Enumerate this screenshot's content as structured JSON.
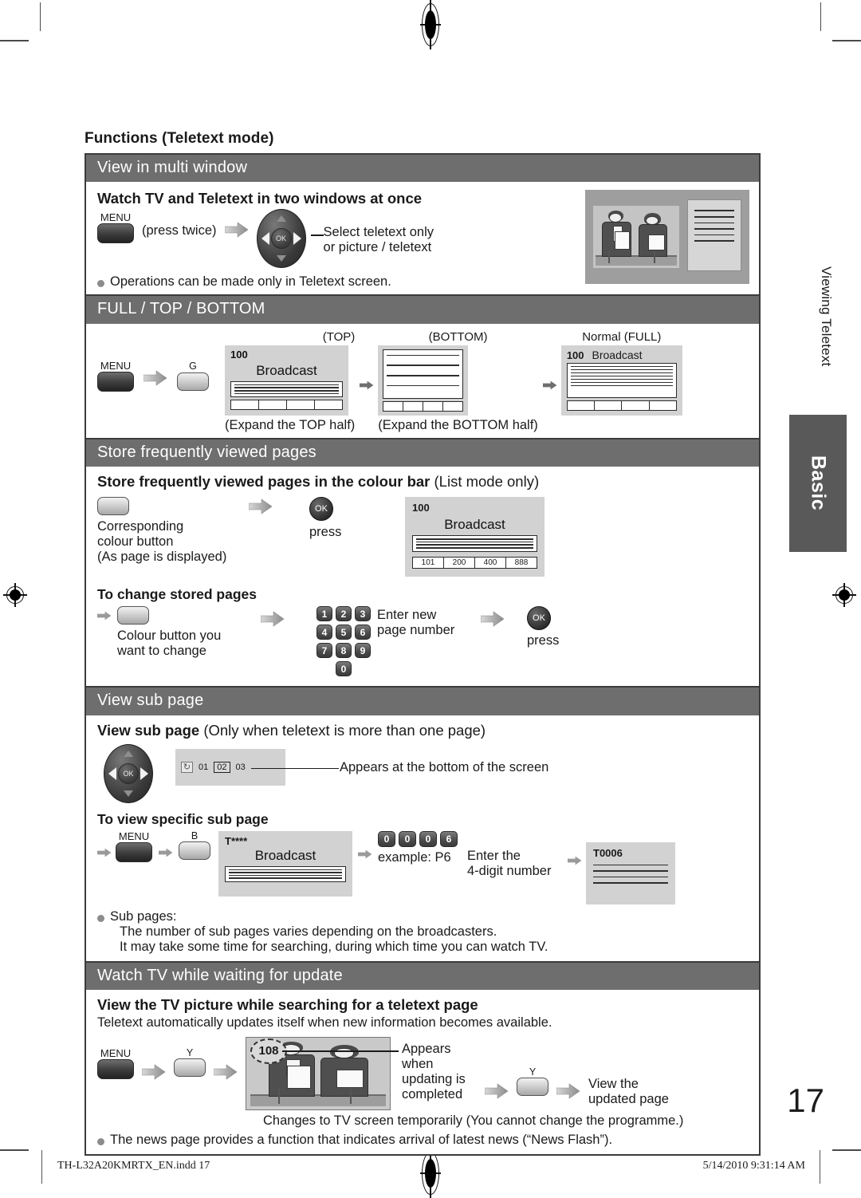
{
  "page": {
    "number": "17",
    "chapter_side_label": "Viewing Teletext",
    "tab_label": "Basic",
    "title": "Functions (Teletext mode)"
  },
  "footer": {
    "file": "TH-L32A20KMRTX_EN.indd   17",
    "timestamp": "5/14/2010   9:31:14 AM"
  },
  "sections": {
    "multi_window": {
      "bar": "View in multi window",
      "heading": "Watch TV and Teletext in two windows at once",
      "menu_label": "MENU",
      "press_twice": "(press twice)",
      "callout_line1": "Select teletext only",
      "callout_line2": "or picture / teletext",
      "note": "Operations can be made only in Teletext screen."
    },
    "full_top_bottom": {
      "bar": "FULL / TOP / BOTTOM",
      "menu_label": "MENU",
      "colour_button": "G",
      "label_top": "(TOP)",
      "label_bottom": "(BOTTOM)",
      "label_full": "Normal (FULL)",
      "caption_top": "(Expand the TOP half)",
      "caption_bottom": "(Expand the BOTTOM half)",
      "screen_page": "100",
      "screen_text": "Broadcast"
    },
    "store_pages": {
      "bar": "Store frequently viewed pages",
      "heading_bold": "Store frequently viewed pages in the colour bar",
      "heading_regular": " (List mode only)",
      "step1_line1": "Corresponding",
      "step1_line2": "colour button",
      "step1_line3": "(As page is displayed)",
      "press_label": "press",
      "ok_label": "OK",
      "screen_page": "100",
      "screen_text": "Broadcast",
      "colour_bar": [
        "101",
        "200",
        "400",
        "888"
      ],
      "change_heading": "To change stored pages",
      "change_line1": "Colour button you",
      "change_line2": "want to change",
      "enter_line1": "Enter new",
      "enter_line2": "page number",
      "numpad": [
        [
          "1",
          "2",
          "3"
        ],
        [
          "4",
          "5",
          "6"
        ],
        [
          "7",
          "8",
          "9"
        ],
        [
          "0"
        ]
      ],
      "press_label2": "press"
    },
    "view_sub_page": {
      "bar": "View sub page",
      "heading_bold": "View sub page",
      "heading_regular": " (Only when teletext is more than one page)",
      "indicator_pages": [
        "01",
        "02",
        "03"
      ],
      "indicator_selected": "02",
      "appears_text": "Appears at the bottom of the screen",
      "specific_heading": "To view specific sub page",
      "menu_label": "MENU",
      "colour_button": "B",
      "screen_code": "T****",
      "screen_text": "Broadcast",
      "digit_keys": [
        "0",
        "0",
        "0",
        "6"
      ],
      "example": "example: P6",
      "enter_line1": "Enter the",
      "enter_line2": "4-digit number",
      "result_code": "T0006",
      "note_title": "Sub pages:",
      "note_line1": "The number of sub pages varies depending on the broadcasters.",
      "note_line2": "It may take some time for searching, during which time you can watch TV."
    },
    "waiting_update": {
      "bar": "Watch TV while waiting for update",
      "heading": "View the TV picture while searching for a teletext page",
      "subtext": "Teletext automatically updates itself when new information becomes available.",
      "menu_label": "MENU",
      "colour_button_1": "Y",
      "colour_button_2": "Y",
      "tv_page_number": "108",
      "callout_l1": "Appears",
      "callout_l2": "when",
      "callout_l3": "updating is",
      "callout_l4": "completed",
      "view_l1": "View the",
      "view_l2": "updated page",
      "caption": "Changes to TV screen temporarily (You cannot change the programme.)",
      "note": "The news page provides a function that indicates arrival of latest news (“News Flash”)."
    }
  },
  "colors": {
    "bar_bg": "#6e6e6e",
    "tab_bg": "#595959",
    "screen_bg": "#d2d2d2",
    "border": "#3c3c3c"
  }
}
